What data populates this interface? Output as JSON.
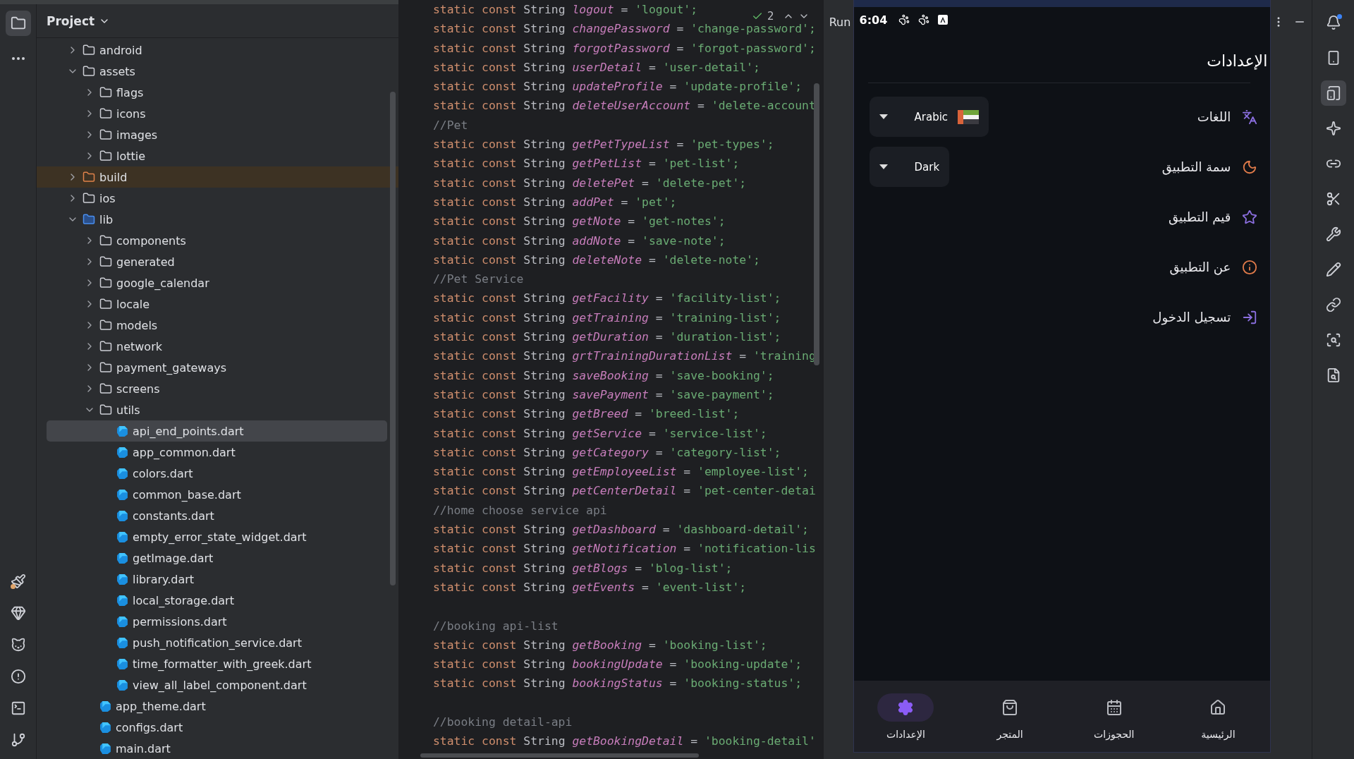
{
  "left_toolbar": [
    {
      "selected": true
    },
    {
      "selected": false
    }
  ],
  "project": {
    "title": "Project",
    "tree": [
      {
        "label": "android",
        "kind": "folder",
        "expanded": false,
        "selected": false
      },
      {
        "label": "assets",
        "kind": "folder",
        "expanded": true,
        "selected": false,
        "children": [
          {
            "label": "flags",
            "kind": "folder",
            "expanded": false,
            "selected": false
          },
          {
            "label": "icons",
            "kind": "folder",
            "expanded": false,
            "selected": false
          },
          {
            "label": "images",
            "kind": "folder",
            "expanded": false,
            "selected": false
          },
          {
            "label": "lottie",
            "kind": "folder",
            "expanded": false,
            "selected": false
          }
        ]
      },
      {
        "label": "build",
        "kind": "excluded-folder",
        "expanded": false,
        "selected": false
      },
      {
        "label": "ios",
        "kind": "folder",
        "expanded": false,
        "selected": false
      },
      {
        "label": "lib",
        "kind": "source-folder",
        "expanded": true,
        "selected": false,
        "children": [
          {
            "label": "components",
            "kind": "folder",
            "expanded": false,
            "selected": false
          },
          {
            "label": "generated",
            "kind": "folder",
            "expanded": false,
            "selected": false
          },
          {
            "label": "google_calendar",
            "kind": "folder",
            "expanded": false,
            "selected": false
          },
          {
            "label": "locale",
            "kind": "folder",
            "expanded": false,
            "selected": false
          },
          {
            "label": "models",
            "kind": "folder",
            "expanded": false,
            "selected": false
          },
          {
            "label": "network",
            "kind": "folder",
            "expanded": false,
            "selected": false
          },
          {
            "label": "payment_gateways",
            "kind": "folder",
            "expanded": false,
            "selected": false
          },
          {
            "label": "screens",
            "kind": "folder",
            "expanded": false,
            "selected": false
          },
          {
            "label": "utils",
            "kind": "folder",
            "expanded": true,
            "selected": false,
            "children": [
              {
                "label": "api_end_points.dart",
                "kind": "file",
                "selected": true
              },
              {
                "label": "app_common.dart",
                "kind": "file",
                "selected": false
              },
              {
                "label": "colors.dart",
                "kind": "file",
                "selected": false
              },
              {
                "label": "common_base.dart",
                "kind": "file",
                "selected": false
              },
              {
                "label": "constants.dart",
                "kind": "file",
                "selected": false
              },
              {
                "label": "empty_error_state_widget.dart",
                "kind": "file",
                "selected": false
              },
              {
                "label": "getImage.dart",
                "kind": "file",
                "selected": false
              },
              {
                "label": "library.dart",
                "kind": "file",
                "selected": false
              },
              {
                "label": "local_storage.dart",
                "kind": "file",
                "selected": false
              },
              {
                "label": "permissions.dart",
                "kind": "file",
                "selected": false
              },
              {
                "label": "push_notification_service.dart",
                "kind": "file",
                "selected": false
              },
              {
                "label": "time_formatter_with_greek.dart",
                "kind": "file",
                "selected": false
              },
              {
                "label": "view_all_label_component.dart",
                "kind": "file",
                "selected": false
              }
            ]
          },
          {
            "label": "app_theme.dart",
            "kind": "file",
            "selected": false
          },
          {
            "label": "configs.dart",
            "kind": "file",
            "selected": false
          },
          {
            "label": "main.dart",
            "kind": "file",
            "selected": false
          }
        ]
      }
    ]
  },
  "editor": {
    "inspection_count": "2",
    "lines": [
      {
        "kind": "decl",
        "parts": [
          "static const",
          "String",
          "logout",
          "=",
          "'logout';"
        ]
      },
      {
        "kind": "decl",
        "parts": [
          "static const",
          "String",
          "changePassword",
          "=",
          "'change-password';"
        ]
      },
      {
        "kind": "decl",
        "parts": [
          "static const",
          "String",
          "forgotPassword",
          "=",
          "'forgot-password';"
        ]
      },
      {
        "kind": "decl",
        "parts": [
          "static const",
          "String",
          "userDetail",
          "=",
          "'user-detail';"
        ]
      },
      {
        "kind": "decl",
        "parts": [
          "static const",
          "String",
          "updateProfile",
          "=",
          "'update-profile';"
        ]
      },
      {
        "kind": "decl",
        "parts": [
          "static const",
          "String",
          "deleteUserAccount",
          "=",
          "'delete-account"
        ]
      },
      {
        "kind": "comment",
        "text": "//Pet"
      },
      {
        "kind": "decl",
        "parts": [
          "static const",
          "String",
          "getPetTypeList",
          "=",
          "'pet-types';"
        ]
      },
      {
        "kind": "decl",
        "parts": [
          "static const",
          "String",
          "getPetList",
          "=",
          "'pet-list';"
        ]
      },
      {
        "kind": "decl",
        "parts": [
          "static const",
          "String",
          "deletePet",
          "=",
          "'delete-pet';"
        ]
      },
      {
        "kind": "decl",
        "parts": [
          "static const",
          "String",
          "addPet",
          "=",
          "'pet';"
        ]
      },
      {
        "kind": "decl",
        "parts": [
          "static const",
          "String",
          "getNote",
          "=",
          "'get-notes';"
        ]
      },
      {
        "kind": "decl",
        "parts": [
          "static const",
          "String",
          "addNote",
          "=",
          "'save-note';"
        ]
      },
      {
        "kind": "decl",
        "parts": [
          "static const",
          "String",
          "deleteNote",
          "=",
          "'delete-note';"
        ]
      },
      {
        "kind": "comment",
        "text": "//Pet Service"
      },
      {
        "kind": "decl",
        "parts": [
          "static const",
          "String",
          "getFacility",
          "=",
          "'facility-list';"
        ]
      },
      {
        "kind": "decl",
        "parts": [
          "static const",
          "String",
          "getTraining",
          "=",
          "'training-list';"
        ]
      },
      {
        "kind": "decl",
        "parts": [
          "static const",
          "String",
          "getDuration",
          "=",
          "'duration-list';"
        ]
      },
      {
        "kind": "decl",
        "parts": [
          "static const",
          "String",
          "grtTrainingDurationList",
          "=",
          "'training"
        ]
      },
      {
        "kind": "decl",
        "parts": [
          "static const",
          "String",
          "saveBooking",
          "=",
          "'save-booking';"
        ]
      },
      {
        "kind": "decl",
        "parts": [
          "static const",
          "String",
          "savePayment",
          "=",
          "'save-payment';"
        ]
      },
      {
        "kind": "decl",
        "parts": [
          "static const",
          "String",
          "getBreed",
          "=",
          "'breed-list';"
        ]
      },
      {
        "kind": "decl",
        "parts": [
          "static const",
          "String",
          "getService",
          "=",
          "'service-list';"
        ]
      },
      {
        "kind": "decl",
        "parts": [
          "static const",
          "String",
          "getCategory",
          "=",
          "'category-list';"
        ]
      },
      {
        "kind": "decl",
        "parts": [
          "static const",
          "String",
          "getEmployeeList",
          "=",
          "'employee-list';"
        ]
      },
      {
        "kind": "decl",
        "parts": [
          "static const",
          "String",
          "petCenterDetail",
          "=",
          "'pet-center-detai"
        ]
      },
      {
        "kind": "comment",
        "text": "//home choose service api"
      },
      {
        "kind": "decl",
        "parts": [
          "static const",
          "String",
          "getDashboard",
          "=",
          "'dashboard-detail';"
        ]
      },
      {
        "kind": "decl",
        "parts": [
          "static const",
          "String",
          "getNotification",
          "=",
          "'notification-lis"
        ]
      },
      {
        "kind": "decl",
        "parts": [
          "static const",
          "String",
          "getBlogs",
          "=",
          "'blog-list';"
        ]
      },
      {
        "kind": "decl",
        "parts": [
          "static const",
          "String",
          "getEvents",
          "=",
          "'event-list';"
        ]
      },
      {
        "kind": "blank"
      },
      {
        "kind": "comment",
        "text": "//booking api-list"
      },
      {
        "kind": "decl",
        "parts": [
          "static const",
          "String",
          "getBooking",
          "=",
          "'booking-list';"
        ]
      },
      {
        "kind": "decl",
        "parts": [
          "static const",
          "String",
          "bookingUpdate",
          "=",
          "'booking-update';"
        ]
      },
      {
        "kind": "decl",
        "parts": [
          "static const",
          "String",
          "bookingStatus",
          "=",
          "'booking-status';"
        ]
      },
      {
        "kind": "blank"
      },
      {
        "kind": "comment",
        "text": "//booking detail-api"
      },
      {
        "kind": "decl",
        "parts": [
          "static const",
          "String",
          "getBookingDetail",
          "=",
          "'booking-detail'"
        ]
      }
    ]
  },
  "run_label": "Run",
  "right_toolbar": [
    {
      "selected": false
    },
    {
      "selected": false
    },
    {
      "selected": true
    },
    {
      "selected": false
    },
    {
      "selected": false
    },
    {
      "selected": false
    },
    {
      "selected": false
    },
    {
      "selected": false
    },
    {
      "selected": false
    },
    {
      "selected": false
    },
    {
      "selected": false
    }
  ],
  "phone": {
    "time": "6:04",
    "title": "الإعدادات",
    "settings": [
      {
        "kind": "language-select",
        "label": "اللغات",
        "color": "#8b6fe0",
        "value": "Arabic"
      },
      {
        "kind": "select",
        "label": "سمة التطبيق",
        "color": "#e07b4a",
        "value": "Dark"
      },
      {
        "kind": "link",
        "label": "قيم التطبيق",
        "color": "#8b6fe0"
      },
      {
        "kind": "link",
        "label": "عن التطبيق",
        "color": "#e07b4a"
      },
      {
        "kind": "link",
        "label": "تسجيل الدخول",
        "color": "#8b6fe0"
      }
    ],
    "nav": [
      {
        "label": "الرئيسية",
        "selected": false
      },
      {
        "label": "الحجوزات",
        "selected": false
      },
      {
        "label": "المتجر",
        "selected": false
      },
      {
        "label": "الإعدادات",
        "selected": true
      }
    ]
  }
}
